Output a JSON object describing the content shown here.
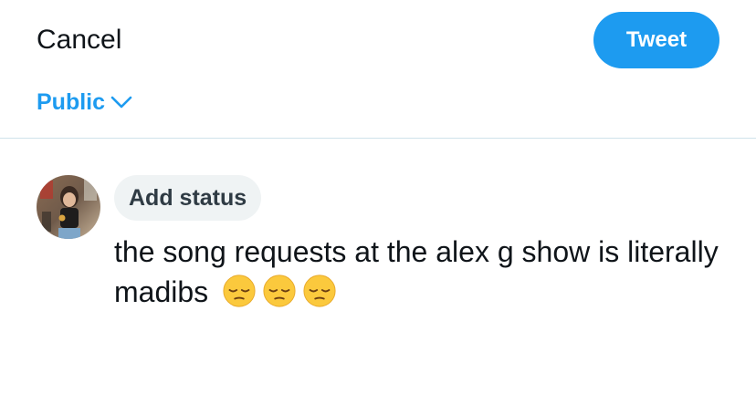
{
  "header": {
    "cancel_label": "Cancel",
    "tweet_label": "Tweet"
  },
  "audience": {
    "label": "Public",
    "icon": "chevron-down-icon"
  },
  "profile": {
    "avatar_icon": "avatar"
  },
  "status": {
    "label": "Add status"
  },
  "compose": {
    "text": "the song requests at the alex g show is literally madibs",
    "emojis": [
      "pensive-face-emoji",
      "pensive-face-emoji",
      "pensive-face-emoji"
    ]
  },
  "colors": {
    "accent": "#1d9bf0",
    "text": "#0f1419",
    "chip_bg": "#eff3f4",
    "divider": "#cfe3ea"
  }
}
